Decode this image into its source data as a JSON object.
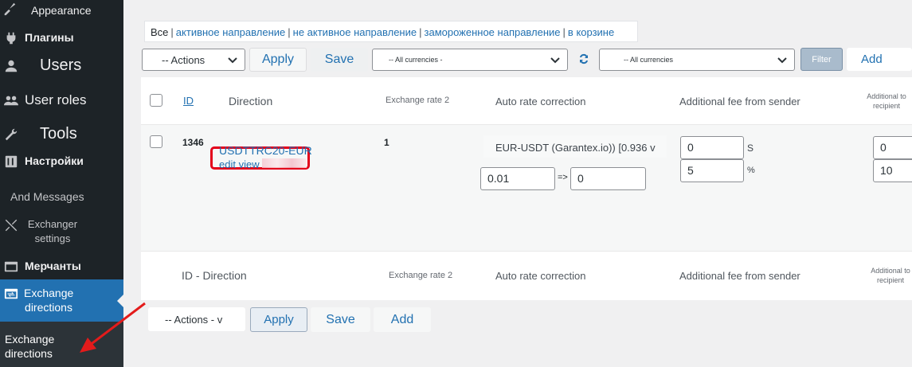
{
  "sidebar": {
    "appearance": "Appearance",
    "plugins": "Плагины",
    "users": "Users",
    "user_roles": "User roles",
    "tools": "Tools",
    "settings": "Настройки",
    "and_messages": "And Messages",
    "exchanger_settings": "Exchanger settings",
    "merchants": "Мерчанты",
    "exchange_directions": "Exchange directions",
    "submenu_exchange_directions": "Exchange directions"
  },
  "filters": {
    "current": "Все",
    "links": [
      "активное направление",
      "не активное направление",
      "замороженное направление",
      "в корзине"
    ]
  },
  "toolbar_top": {
    "actions": "-- Actions",
    "apply": "Apply",
    "save": "Save",
    "currency_from": "-- All currencies -",
    "currency_to": "-- All currencies",
    "filter": "Filter",
    "add": "Add"
  },
  "table": {
    "headers": {
      "id": "ID",
      "direction": "Direction",
      "exchange_rate": "Exchange rate 2",
      "auto_rate": "Auto rate correction",
      "fee_sender": "Additional fee from sender",
      "fee_recipient": "Additional to recipient"
    },
    "row": {
      "id": "1346",
      "direction": "USDTTRC20-EUR",
      "edit_view": "edit view",
      "exchange_rate": "1",
      "auto_rate_source": "EUR-USDT (Garantex.io)) [0.936 v",
      "auto_rate_from": "0.01",
      "auto_rate_arrow": "=>",
      "auto_rate_to": "0",
      "fee_sender_fixed": "0",
      "fee_sender_fixed_unit": "S",
      "fee_sender_percent": "5",
      "fee_sender_percent_unit": "%",
      "fee_recipient_fixed": "0",
      "fee_recipient_percent": "10"
    },
    "footer": {
      "id_direction": "ID - Direction",
      "exchange_rate": "Exchange rate 2",
      "auto_rate": "Auto rate correction",
      "fee_sender": "Additional fee from sender",
      "fee_recipient": "Additional to recipient"
    }
  },
  "toolbar_bottom": {
    "actions": "-- Actions - v",
    "apply": "Apply",
    "save": "Save",
    "add": "Add"
  },
  "colors": {
    "sidebar_bg": "#1d2327",
    "active_menu": "#2271b1",
    "link": "#2271b1",
    "highlight_box": "#e3001b",
    "annotation_arrow": "#e31b1b"
  }
}
